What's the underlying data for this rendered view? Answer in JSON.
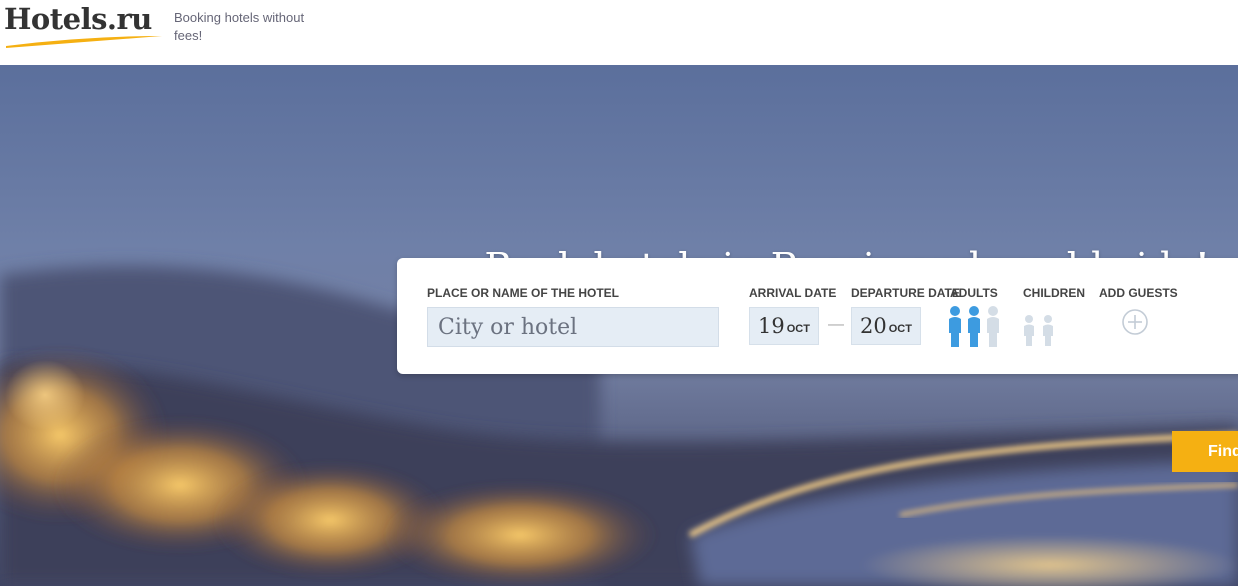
{
  "header": {
    "logo_text": "Hotels.ru",
    "tagline": "Booking hotels without fees!"
  },
  "hero": {
    "headline": "Book hotels in Russia and worldwide!"
  },
  "search": {
    "place_label": "PLACE OR NAME OF THE HOTEL",
    "place_placeholder": "City or hotel",
    "arrival_label": "ARRIVAL DATE",
    "arrival_day": "19",
    "arrival_month": "OCT",
    "departure_label": "DEPARTURE DATE",
    "departure_day": "20",
    "departure_month": "OCT",
    "date_separator": "—",
    "adults_label": "ADULTS",
    "adults_selected": 2,
    "adults_max": 3,
    "children_label": "CHILDREN",
    "children_selected": 0,
    "add_guests_label": "ADD GUESTS",
    "find_button": "Find"
  },
  "colors": {
    "brand_accent": "#f5b012",
    "person_active": "#3d9be0",
    "person_inactive": "#d4dde6",
    "input_bg": "#e5edf5"
  },
  "icons": {
    "add_guests": "plus-circle-icon",
    "adult": "person-icon",
    "child": "child-person-icon"
  }
}
